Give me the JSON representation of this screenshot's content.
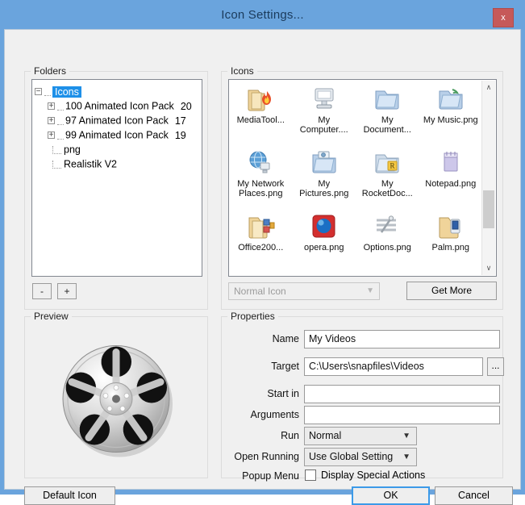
{
  "window": {
    "title": "Icon Settings...",
    "close_label": "x",
    "accent_color": "#6aa4dd",
    "close_color": "#c65959"
  },
  "folders": {
    "group_label": "Folders",
    "tree": [
      {
        "label": "Icons",
        "expander": "minus",
        "selected": true,
        "count": ""
      },
      {
        "label": "100 Animated Icon Pack",
        "expander": "plus",
        "selected": false,
        "count": "20"
      },
      {
        "label": "97 Animated Icon Pack",
        "expander": "plus",
        "selected": false,
        "count": "17"
      },
      {
        "label": "99 Animated Icon Pack",
        "expander": "plus",
        "selected": false,
        "count": "19"
      },
      {
        "label": "png",
        "expander": "none",
        "selected": false,
        "count": ""
      },
      {
        "label": "Realistik V2",
        "expander": "none",
        "selected": false,
        "count": ""
      }
    ],
    "remove_label": "-",
    "add_label": "+"
  },
  "icons_panel": {
    "group_label": "Icons",
    "items": [
      {
        "name": "MediaTool...",
        "icon": "folder-flame-icon"
      },
      {
        "name": "My Computer....",
        "icon": "my-computer-icon"
      },
      {
        "name": "My Document...",
        "icon": "folder-documents-icon"
      },
      {
        "name": "My Music.png",
        "icon": "folder-music-icon"
      },
      {
        "name": "My Network Places.png",
        "icon": "network-globe-icon"
      },
      {
        "name": "My Pictures.png",
        "icon": "folder-pictures-icon"
      },
      {
        "name": "My RocketDoc...",
        "icon": "folder-rocketdock-icon"
      },
      {
        "name": "Notepad.png",
        "icon": "notepad-icon"
      },
      {
        "name": "Office200...",
        "icon": "folder-office-icon"
      },
      {
        "name": "opera.png",
        "icon": "opera-icon"
      },
      {
        "name": "Options.png",
        "icon": "options-sliders-icon"
      },
      {
        "name": "Palm.png",
        "icon": "folder-palm-icon"
      },
      {
        "name": "",
        "icon": "folder-restore-icon"
      },
      {
        "name": "",
        "icon": "trash-black-icon"
      },
      {
        "name": "",
        "icon": "trash-full-icon"
      },
      {
        "name": "",
        "icon": "recycle-bin-icon"
      }
    ],
    "icon_type_value": "Normal Icon",
    "get_more_label": "Get More",
    "scroll_up": "∧",
    "scroll_down": "∨"
  },
  "preview": {
    "group_label": "Preview",
    "image_name": "film-reel-icon"
  },
  "properties": {
    "group_label": "Properties",
    "fields": [
      {
        "label": "Name",
        "value": "My Videos",
        "placeholder": ""
      },
      {
        "label": "Target",
        "value": "C:\\Users\\snapfiles\\Videos",
        "placeholder": ""
      },
      {
        "label": "Start in",
        "value": "",
        "placeholder": ""
      },
      {
        "label": "Arguments",
        "value": "",
        "placeholder": ""
      }
    ],
    "browse_label": "...",
    "run": {
      "label": "Run",
      "value": "Normal"
    },
    "open_running": {
      "label": "Open Running",
      "value": "Use Global Setting"
    },
    "popup_menu": {
      "label": "Popup Menu",
      "checkbox_label": "Display Special Actions",
      "checked": false
    }
  },
  "footer": {
    "default_icon_label": "Default Icon",
    "ok_label": "OK",
    "cancel_label": "Cancel"
  }
}
